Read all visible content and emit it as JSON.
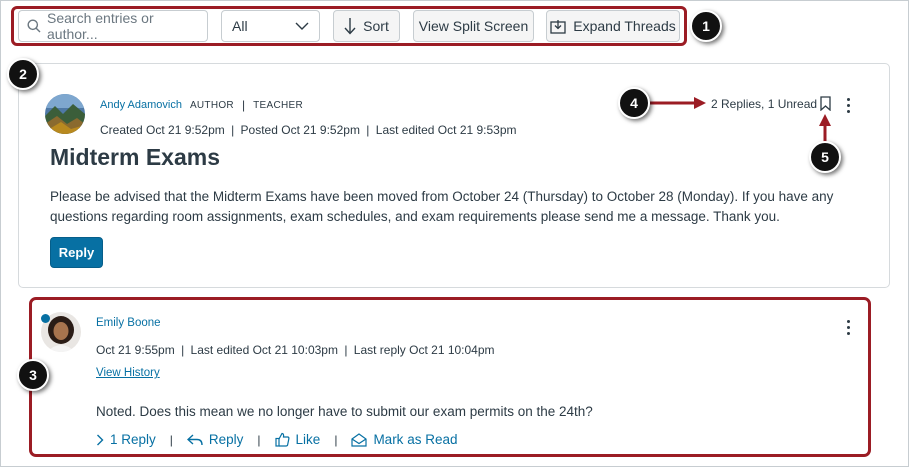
{
  "toolbar": {
    "search_placeholder": "Search entries or author...",
    "filter_value": "All",
    "sort_label": "Sort",
    "split_label": "View Split Screen",
    "expand_label": "Expand Threads"
  },
  "callouts": [
    "1",
    "2",
    "3",
    "4",
    "5"
  ],
  "post": {
    "author": "Andy Adamovich",
    "role_author": "AUTHOR",
    "role_teacher": "TEACHER",
    "created": "Created Oct 21 9:52pm",
    "posted": "Posted Oct 21 9:52pm",
    "edited": "Last edited Oct 21 9:53pm",
    "title": "Midterm Exams",
    "body": "Please be advised that the Midterm Exams have been moved from October 24 (Thursday) to October 28 (Monday). If you have any questions regarding room assignments, exam schedules, and exam requirements please send me a message. Thank you.",
    "reply_label": "Reply",
    "counts": "2 Replies, 1 Unread"
  },
  "entry": {
    "author": "Emily Boone",
    "date": "Oct 21 9:55pm",
    "edited": "Last edited Oct 21 10:03pm",
    "last_reply": "Last reply Oct 21 10:04pm",
    "history_link": "View History",
    "message": "Noted. Does this mean we no longer have to submit our exam permits on the 24th?",
    "replies_label": "1 Reply",
    "reply_label": "Reply",
    "like_label": "Like",
    "mark_read_label": "Mark as Read"
  },
  "colors": {
    "link": "#0770a3",
    "annotation": "#9b1c24",
    "text": "#2d3b45"
  },
  "icons": [
    "search-icon",
    "chevron-down-icon",
    "sort-arrow-icon",
    "expand-icon",
    "bookmark-icon",
    "kebab-icon",
    "chevron-right-icon",
    "reply-arrow-icon",
    "thumbs-up-icon",
    "envelope-icon"
  ]
}
